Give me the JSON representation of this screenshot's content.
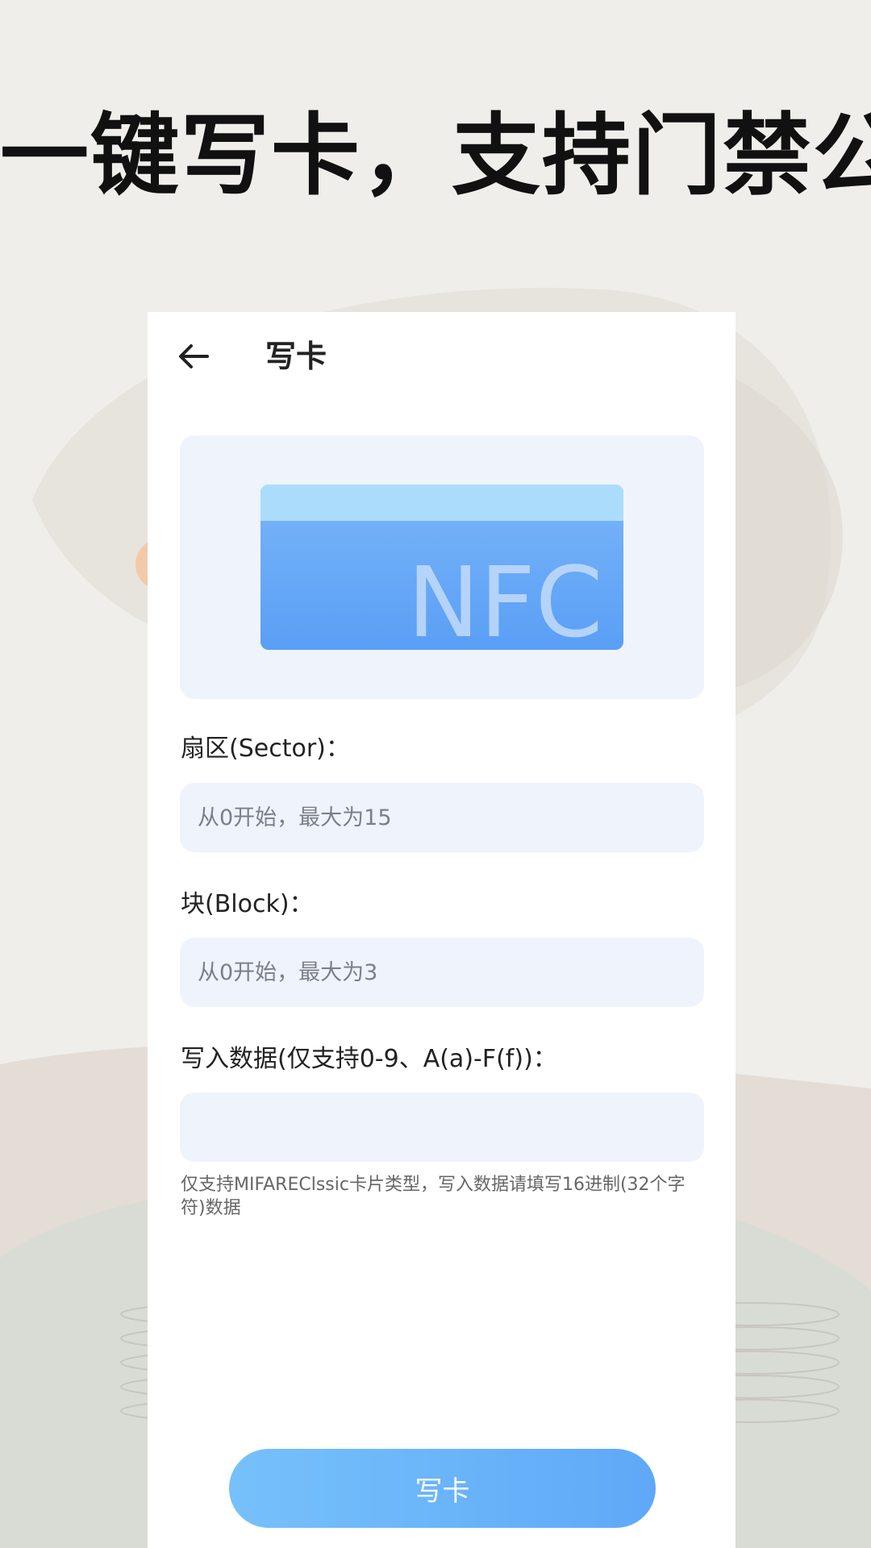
{
  "headline": "一键写卡，支持门禁公交",
  "screen": {
    "title": "写卡",
    "back_icon": "arrow-left-icon",
    "banner": {
      "card_text": "NFC",
      "icon": "nfc-card-icon"
    },
    "fields": [
      {
        "label": "扇区(Sector)：",
        "placeholder": "从0开始，最大为15",
        "value": ""
      },
      {
        "label": "块(Block)：",
        "placeholder": "从0开始，最大为3",
        "value": ""
      },
      {
        "label": "写入数据(仅支持0-9、A(a)-F(f))：",
        "placeholder": "",
        "value": ""
      }
    ],
    "hint": "仅支持MIFAREClssic卡片类型，写入数据请填写16进制(32个字符)数据",
    "write_button": "写卡"
  },
  "colors": {
    "accent_start": "#76c1fb",
    "accent_end": "#5fa8f8",
    "field_bg": "#eff3fc",
    "page_bg": "#efeeeb"
  }
}
